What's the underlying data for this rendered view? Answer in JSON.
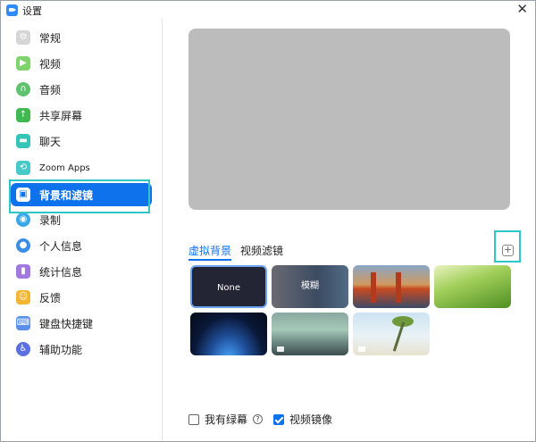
{
  "window": {
    "title": "设置",
    "close_glyph": "✕"
  },
  "sidebar": {
    "items": [
      {
        "label": "常规",
        "icon": "gear-icon",
        "color": "#d6d6d6",
        "glyph": "⚙",
        "round": false
      },
      {
        "label": "视频",
        "icon": "video-icon",
        "color": "#7ed36c",
        "glyph": "▶",
        "round": false
      },
      {
        "label": "音频",
        "icon": "headphones-icon",
        "color": "#5fc26e",
        "glyph": "∩",
        "round": true
      },
      {
        "label": "共享屏幕",
        "icon": "share-screen-icon",
        "color": "#3fb950",
        "glyph": "↑",
        "round": false
      },
      {
        "label": "聊天",
        "icon": "chat-icon",
        "color": "#35c4b8",
        "glyph": "▬",
        "round": false
      },
      {
        "label": "Zoom Apps",
        "icon": "zoom-apps-icon",
        "color": "#48c9c9",
        "glyph": "⟲",
        "round": false
      },
      {
        "label": "背景和滤镜",
        "icon": "background-icon",
        "color": "#0e72ed",
        "glyph": "▣",
        "round": false
      },
      {
        "label": "录制",
        "icon": "record-icon",
        "color": "#3aa7e8",
        "glyph": "◉",
        "round": true
      },
      {
        "label": "个人信息",
        "icon": "profile-icon",
        "color": "#3a8ee6",
        "glyph": "●",
        "round": true
      },
      {
        "label": "统计信息",
        "icon": "statistics-icon",
        "color": "#a178e0",
        "glyph": "▮",
        "round": false
      },
      {
        "label": "反馈",
        "icon": "feedback-icon",
        "color": "#f2b632",
        "glyph": "☺",
        "round": false
      },
      {
        "label": "键盘快捷键",
        "icon": "keyboard-icon",
        "color": "#5a8fe8",
        "glyph": "⌨",
        "round": false
      },
      {
        "label": "辅助功能",
        "icon": "accessibility-icon",
        "color": "#5a6fe0",
        "glyph": "♿",
        "round": true
      }
    ],
    "active_index": 6
  },
  "main": {
    "tabs": [
      {
        "label": "虚拟背景",
        "active": true
      },
      {
        "label": "视频滤镜",
        "active": false
      }
    ],
    "add_glyph": "+",
    "backgrounds": [
      {
        "caption": "None",
        "selected": true
      },
      {
        "caption": "模糊",
        "selected": false
      },
      {
        "caption": "",
        "selected": false
      },
      {
        "caption": "",
        "selected": false
      },
      {
        "caption": "",
        "selected": false
      },
      {
        "caption": "",
        "selected": false
      },
      {
        "caption": "",
        "selected": false
      }
    ],
    "options": {
      "green_screen_label": "我有绿幕",
      "green_screen_checked": false,
      "help_glyph": "?",
      "mirror_label": "视频镜像",
      "mirror_checked": true
    }
  }
}
